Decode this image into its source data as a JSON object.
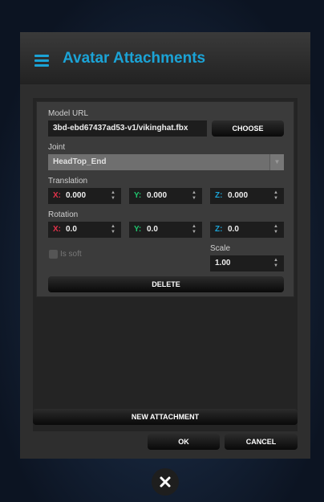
{
  "header": {
    "title": "Avatar Attachments"
  },
  "attachment": {
    "model_url_label": "Model URL",
    "model_url_value": "3bd-ebd67437ad53-v1/vikinghat.fbx",
    "choose_label": "CHOOSE",
    "joint_label": "Joint",
    "joint_value": "HeadTop_End",
    "translation_label": "Translation",
    "translation": {
      "x": "0.000",
      "y": "0.000",
      "z": "0.000"
    },
    "rotation_label": "Rotation",
    "rotation": {
      "x": "0.0",
      "y": "0.0",
      "z": "0.0"
    },
    "scale_label": "Scale",
    "scale_value": "1.00",
    "is_soft_label": "Is soft",
    "delete_label": "DELETE",
    "axis_labels": {
      "x": "X:",
      "y": "Y:",
      "z": "Z:"
    }
  },
  "footer": {
    "new_attachment_label": "NEW ATTACHMENT",
    "ok_label": "OK",
    "cancel_label": "CANCEL"
  },
  "colors": {
    "accent": "#1ba3d6",
    "x_axis": "#e3324a",
    "y_axis": "#1fc66e",
    "z_axis": "#1ba3d6"
  }
}
